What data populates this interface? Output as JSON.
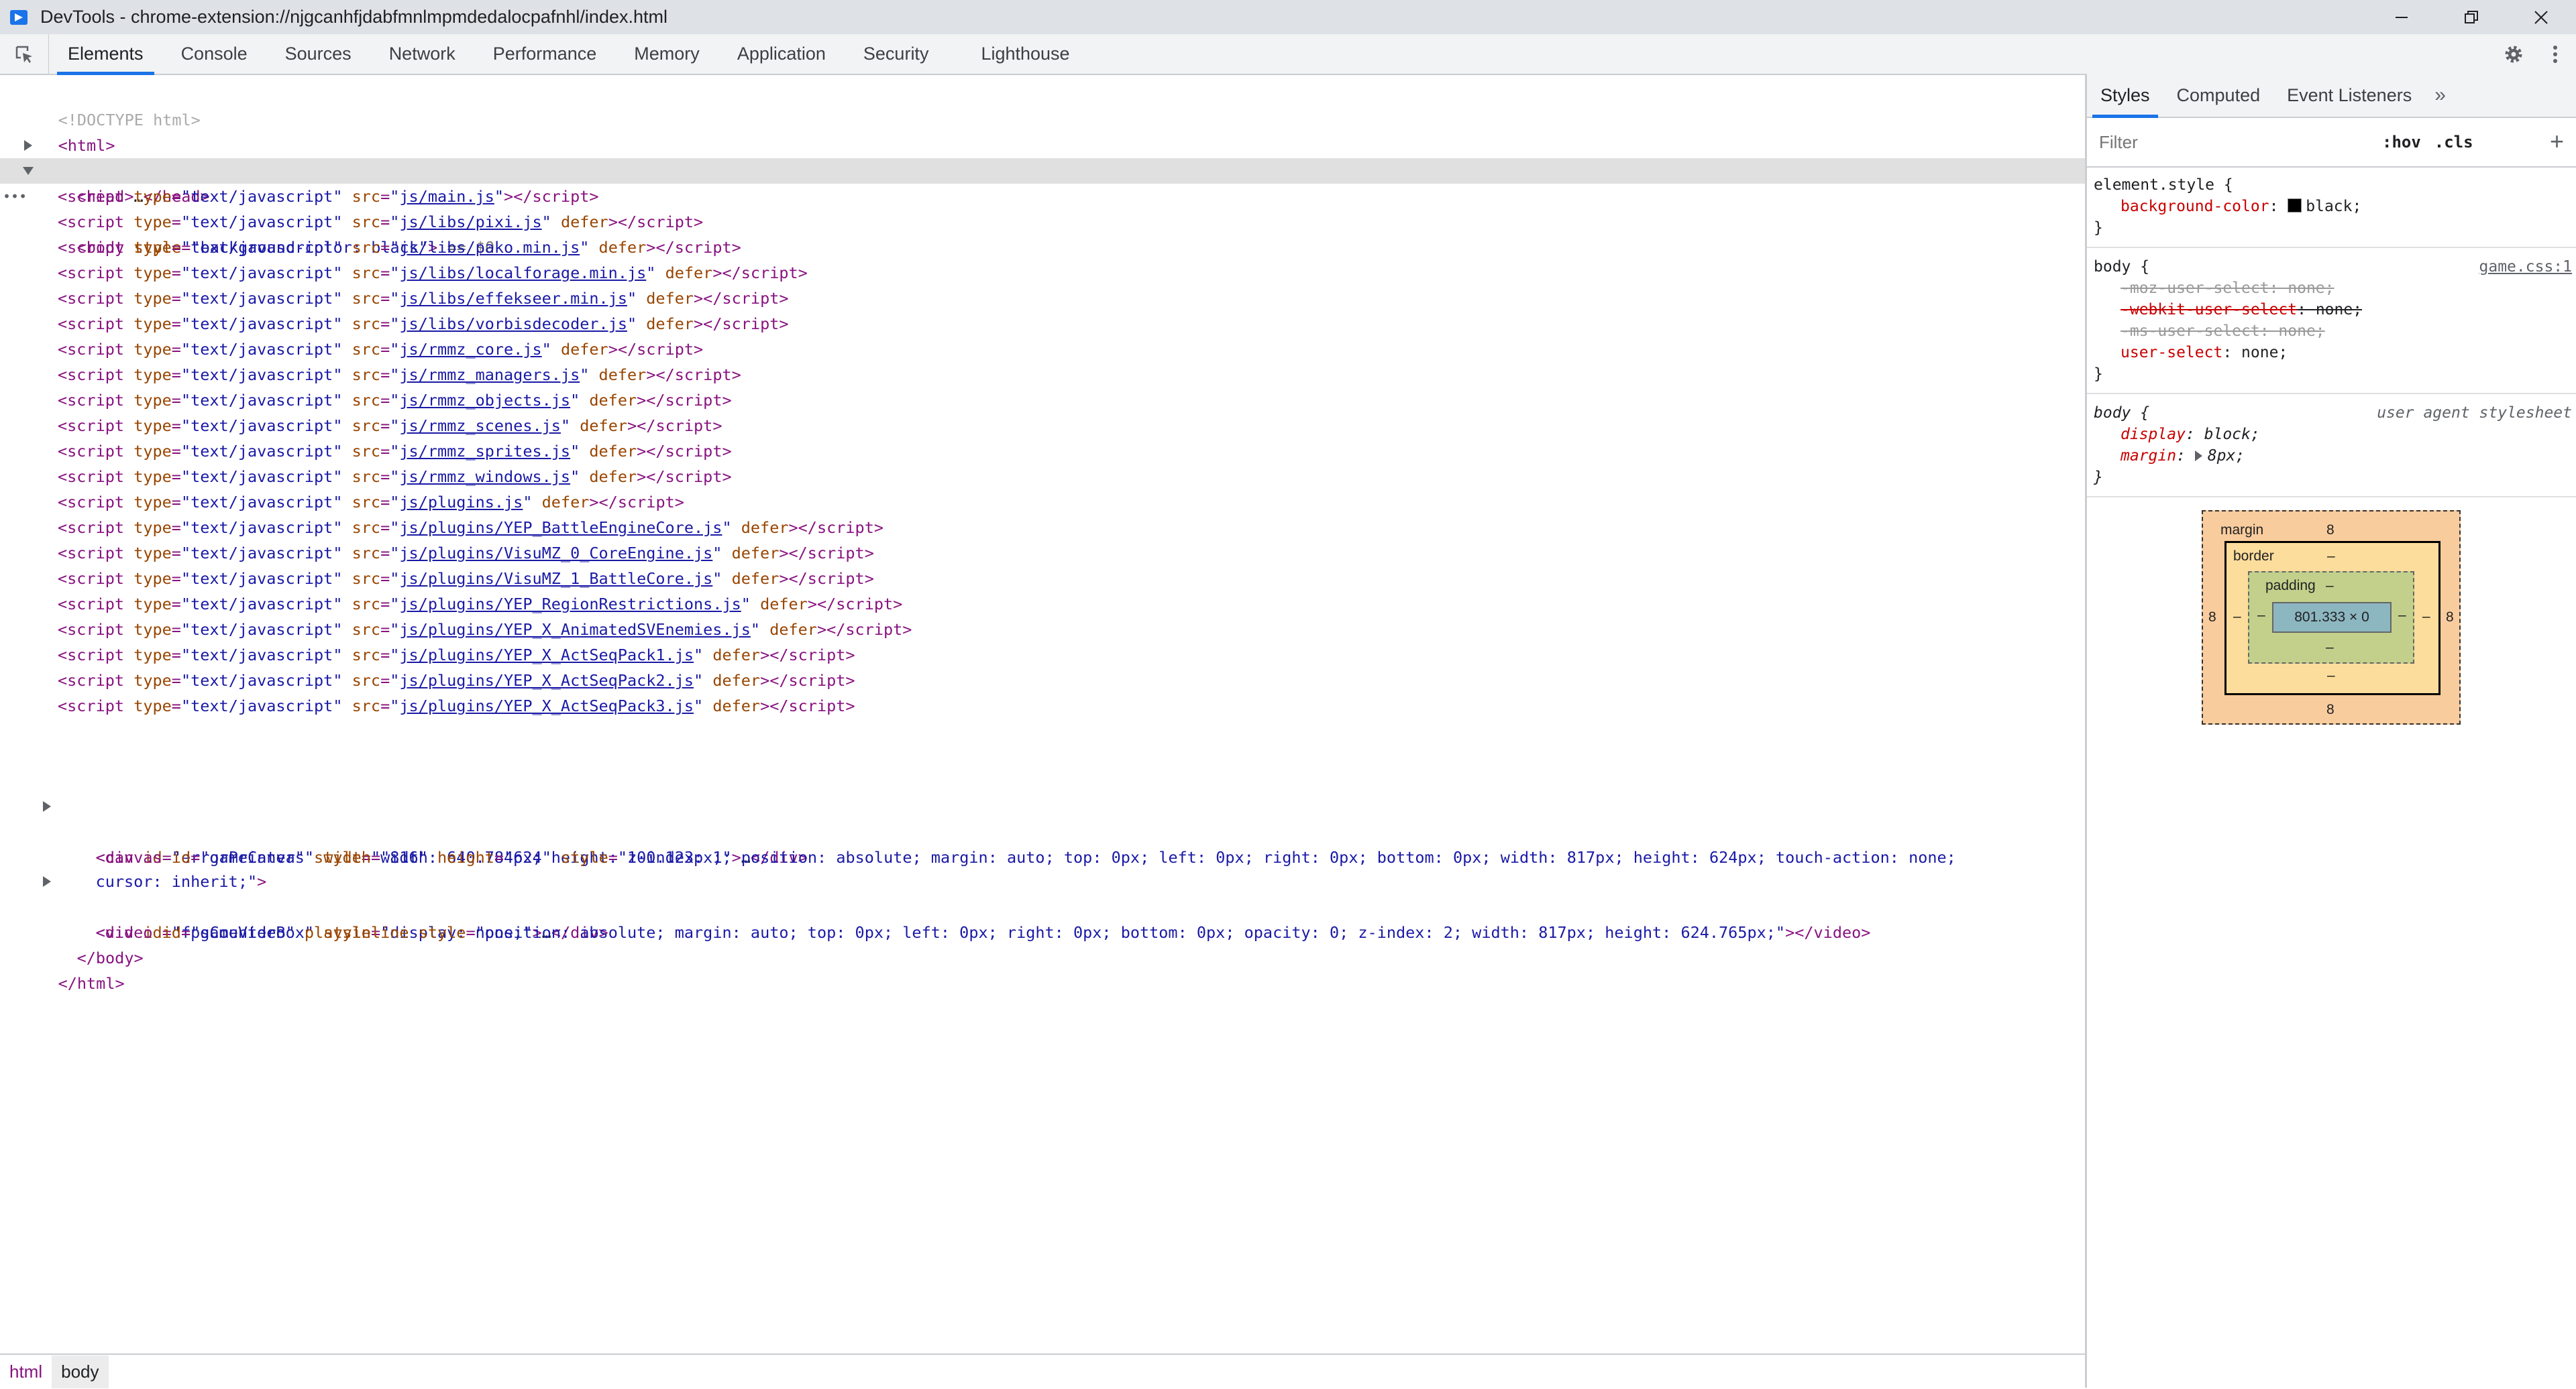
{
  "window": {
    "title": "DevTools - chrome-extension://njgcanhfjdabfmnlmpmdedalocpafnhl/index.html"
  },
  "main_tabs": [
    "Elements",
    "Console",
    "Sources",
    "Network",
    "Performance",
    "Memory",
    "Application",
    "Security",
    "Lighthouse"
  ],
  "dom": {
    "doctype": "<!DOCTYPE html>",
    "html_open": "<html>",
    "head": {
      "open": "<head>",
      "ellipsis": "…",
      "close": "</head>"
    },
    "body": {
      "tag": "<body",
      "attr": "style",
      "value": "background-color: black",
      "close_bracket": ">",
      "selected_marker": " == $0"
    },
    "scripts": [
      {
        "src": "js/main.js",
        "defer": false
      },
      {
        "src": "js/libs/pixi.js",
        "defer": true
      },
      {
        "src": "js/libs/pako.min.js",
        "defer": true
      },
      {
        "src": "js/libs/localforage.min.js",
        "defer": true
      },
      {
        "src": "js/libs/effekseer.min.js",
        "defer": true
      },
      {
        "src": "js/libs/vorbisdecoder.js",
        "defer": true
      },
      {
        "src": "js/rmmz_core.js",
        "defer": true
      },
      {
        "src": "js/rmmz_managers.js",
        "defer": true
      },
      {
        "src": "js/rmmz_objects.js",
        "defer": true
      },
      {
        "src": "js/rmmz_scenes.js",
        "defer": true
      },
      {
        "src": "js/rmmz_sprites.js",
        "defer": true
      },
      {
        "src": "js/rmmz_windows.js",
        "defer": true
      },
      {
        "src": "js/plugins.js",
        "defer": true
      },
      {
        "src": "js/plugins/YEP_BattleEngineCore.js",
        "defer": true
      },
      {
        "src": "js/plugins/VisuMZ_0_CoreEngine.js",
        "defer": true
      },
      {
        "src": "js/plugins/VisuMZ_1_BattleCore.js",
        "defer": true
      },
      {
        "src": "js/plugins/YEP_RegionRestrictions.js",
        "defer": true
      },
      {
        "src": "js/plugins/YEP_X_AnimatedSVEnemies.js",
        "defer": true
      },
      {
        "src": "js/plugins/YEP_X_ActSeqPack1.js",
        "defer": true
      },
      {
        "src": "js/plugins/YEP_X_ActSeqPack2.js",
        "defer": true
      },
      {
        "src": "js/plugins/YEP_X_ActSeqPack3.js",
        "defer": true
      }
    ],
    "error_printer": {
      "id": "errorPrinter",
      "style": "width: 640.784px; height: 100.123px;"
    },
    "canvas": {
      "id": "gameCanvas",
      "width": "816",
      "height": "624",
      "style_line1": "z-index: 1; position: absolute; margin: auto; top: 0px; left: 0px; right: 0px; bottom: 0px; width: 817px; height: 624px; touch-action: none;",
      "style_line2": "cursor: inherit;"
    },
    "fps_box": {
      "id": "fpsCounterBox",
      "style": "display: none;"
    },
    "video": {
      "id": "gameVideo",
      "style": "position: absolute; margin: auto; top: 0px; left: 0px; right: 0px; bottom: 0px; opacity: 0; z-index: 2; width: 817px; height: 624.765px;"
    },
    "body_close": "</body>",
    "html_close": "</html>"
  },
  "breadcrumb": [
    "html",
    "body"
  ],
  "styles_pane": {
    "tabs": [
      "Styles",
      "Computed",
      "Event Listeners"
    ],
    "more": "»",
    "filter_placeholder": "Filter",
    "hov": ":hov",
    "cls": ".cls",
    "plus": "+",
    "rules": {
      "element_style": {
        "selector": "element.style {",
        "prop": "background-color",
        "value": "black;"
      },
      "body_game": {
        "selector": "body {",
        "origin": "game.css:1",
        "props": [
          {
            "name": "-moz-user-select",
            "value": "none;"
          },
          {
            "name": "-webkit-user-select",
            "value": "none;"
          },
          {
            "name": "-ms-user-select",
            "value": "none;"
          },
          {
            "name": "user-select",
            "value": "none;"
          }
        ]
      },
      "body_ua": {
        "selector": "body {",
        "origin": "user agent stylesheet",
        "props": [
          {
            "name": "display",
            "value": "block;"
          },
          {
            "name": "margin",
            "value": "8px;"
          }
        ]
      },
      "close": "}"
    },
    "box_model": {
      "margin_label": "margin",
      "margin_top": "8",
      "margin_bottom": "8",
      "margin_left": "8",
      "margin_right": "8",
      "border_label": "border",
      "border_dash": "–",
      "padding_label": "padding",
      "padding_dash": "–",
      "content": "801.333 × 0"
    }
  }
}
